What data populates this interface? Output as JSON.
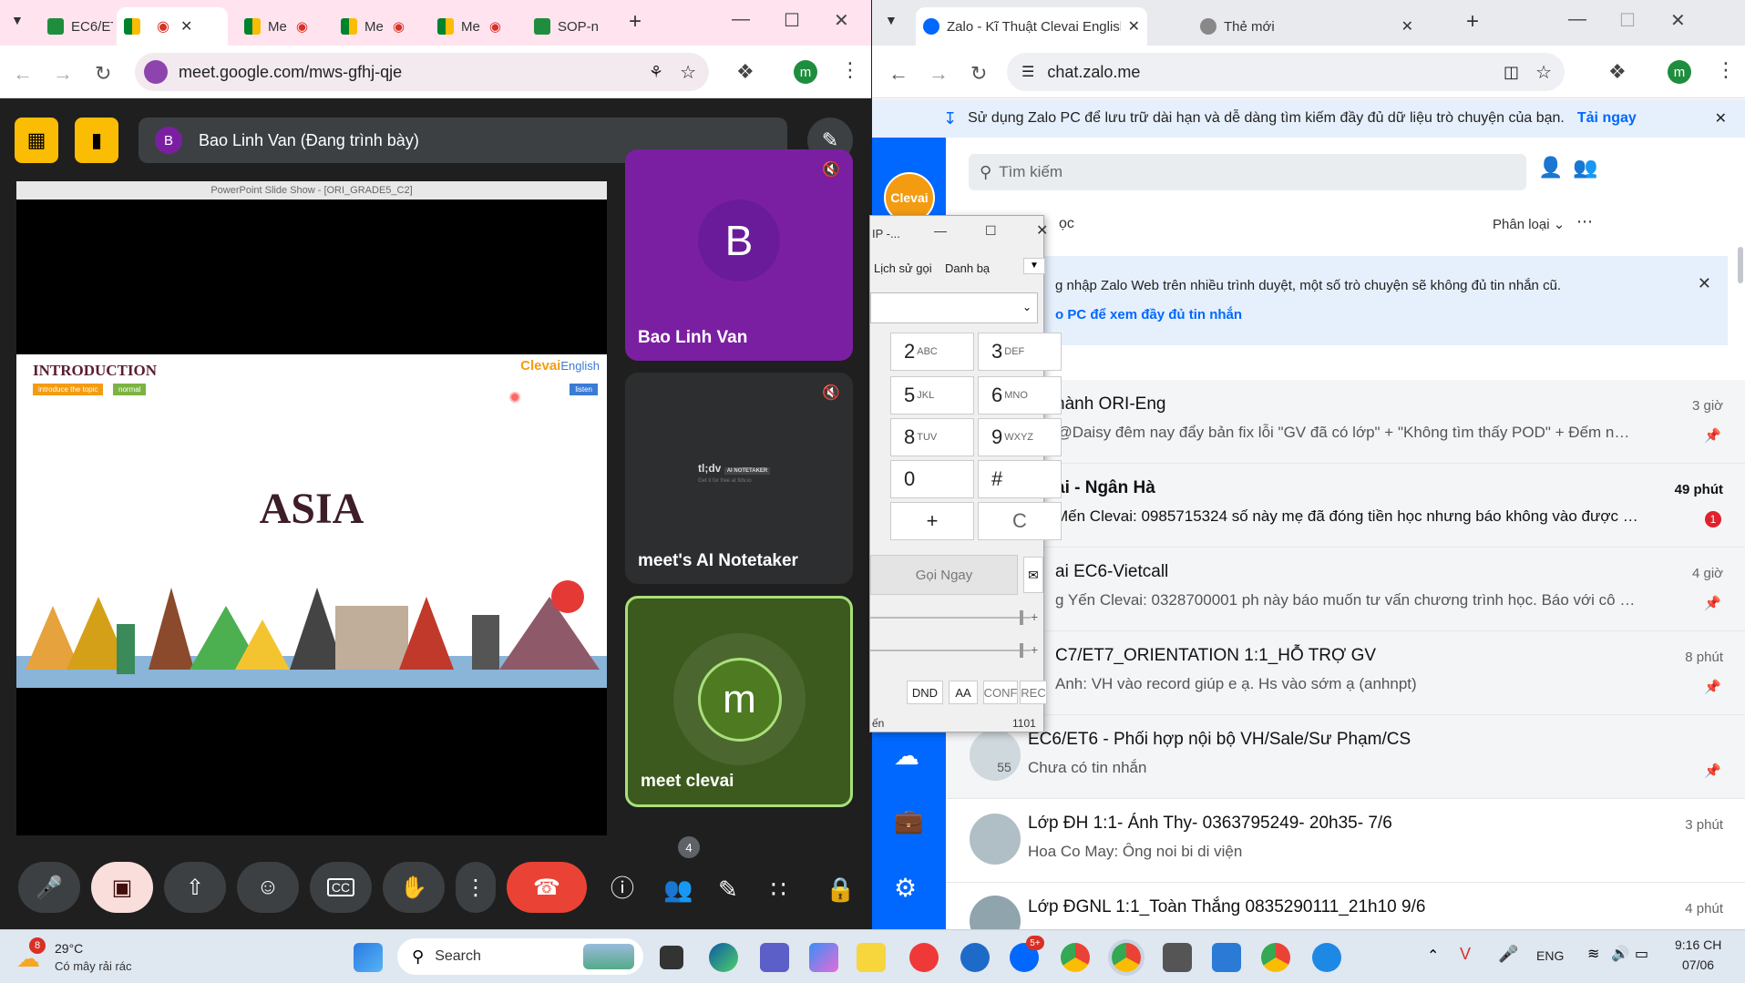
{
  "left_window": {
    "tabs": [
      {
        "label": "EC6/ET",
        "icon": "sheets-icon"
      },
      {
        "label": "",
        "icon": "meet-icon"
      },
      {
        "label": "Me",
        "icon": "meet-icon"
      },
      {
        "label": "Me",
        "icon": "meet-icon"
      },
      {
        "label": "Me",
        "icon": "meet-icon"
      },
      {
        "label": "SOP-n",
        "icon": "sheets-icon"
      }
    ],
    "url": "meet.google.com/mws-gfhj-qje",
    "profile": "m"
  },
  "meet": {
    "presenter_initial": "B",
    "presenter_label": "Bao Linh Van (Đang trình bày)",
    "ppt_title": "PowerPoint Slide Show - [ORI_GRADE5_C2]",
    "slide": {
      "heading": "INTRODUCTION",
      "tag1": "introduce the topic",
      "tag2": "normal",
      "tag3": "listen",
      "brand": "Clevai",
      "brand2": "English",
      "title": "ASIA"
    },
    "tiles": [
      {
        "name": "Bao Linh Van",
        "initial": "B"
      },
      {
        "name": "meet's AI Notetaker",
        "logo": "tl;dv",
        "logo_tag": "AI NOTETAKER",
        "logo_sub": "Get it for free at tldv.io"
      },
      {
        "name": "meet clevai",
        "initial": "m"
      }
    ],
    "people_count": "4"
  },
  "right_window": {
    "tabs": [
      {
        "label": "Zalo - Kĩ Thuật Clevai English",
        "icon": "zalo-icon"
      },
      {
        "label": "Thẻ mới",
        "icon": "chrome-icon"
      }
    ],
    "url": "chat.zalo.me",
    "profile": "m"
  },
  "zalo": {
    "banner_text": "Sử dụng Zalo PC để lưu trữ dài hạn và dễ dàng tìm kiếm đầy đủ dữ liệu trò chuyện của bạn.",
    "banner_link": "Tải ngay",
    "brand": "Clevai",
    "search_placeholder": "Tìm kiếm",
    "tab_partial": "ọc",
    "sort_label": "Phân loại",
    "notice_text": "g nhập Zalo Web trên nhiều trình duyệt, một số trò chuyện sẽ không đủ tin nhắn cũ.",
    "notice_link": "o PC để xem đầy đủ tin nhắn",
    "conversations": [
      {
        "title": "hành ORI-Eng",
        "msg": ": @Daisy đêm nay đẩy bản fix lỗi \"GV đã có lớp\" + \"Không tìm thấy POD\" + Đếm ngược...",
        "time": "3 giờ",
        "pinned": true
      },
      {
        "title": "ai - Ngân Hà",
        "msg": "Mến Clevai: 0985715324 số này mẹ đã đóng tiền học nhưng báo không vào được lớp ...",
        "time": "49 phút",
        "unread": "1",
        "bold": true
      },
      {
        "title": "ai EC6-Vietcall",
        "msg": "g Yến Clevai: 0328700001 ph này báo muốn tư vấn chương trình học. Báo với cô Ngọc ...",
        "time": "4 giờ",
        "pinned": true
      },
      {
        "title": "C7/ET7_ORIENTATION 1:1_HỖ TRỢ GV",
        "msg": "Anh: VH vào record giúp e ạ. Hs vào sớm ạ (anhnpt)",
        "time": "8 phút",
        "pinned": true
      },
      {
        "title": "EC6/ET6 - Phối hợp nội bộ VH/Sale/Sư Phạm/CS",
        "msg": "Chưa có tin nhắn",
        "time": "",
        "pinned": true,
        "badge": "55"
      },
      {
        "title": "Lớp ĐH 1:1- Ánh Thy- 0363795249- 20h35- 7/6",
        "msg": "Hoa Co May: Ông noi bi di viện",
        "time": "3 phút"
      },
      {
        "title": "Lớp ĐGNL 1:1_Toàn Thắng 0835290111_21h10  9/6",
        "msg": "",
        "time": "4 phút"
      }
    ]
  },
  "softphone": {
    "title": "IP -...",
    "tab1": "Lịch sử gọi",
    "tab2": "Danh bạ",
    "keys": [
      {
        "d": "2",
        "l": "ABC"
      },
      {
        "d": "3",
        "l": "DEF"
      },
      {
        "d": "5",
        "l": "JKL"
      },
      {
        "d": "6",
        "l": "MNO"
      },
      {
        "d": "8",
        "l": "TUV"
      },
      {
        "d": "9",
        "l": "WXYZ"
      },
      {
        "d": "0",
        "l": ""
      },
      {
        "d": "#",
        "l": ""
      },
      {
        "d": "+",
        "l": ""
      },
      {
        "d": "C",
        "l": ""
      }
    ],
    "call_btn": "Gọi Ngay",
    "dnd": "DND",
    "aa": "AA",
    "conf": "CONF",
    "rec": "REC",
    "status": "ến",
    "ext": "1101"
  },
  "taskbar": {
    "weather_badge": "8",
    "temp": "29°C",
    "weather": "Có mây rải rác",
    "search": "Search",
    "zalo_badge": "5+",
    "lang": "ENG",
    "time": "9:16 CH",
    "date": "07/06"
  }
}
